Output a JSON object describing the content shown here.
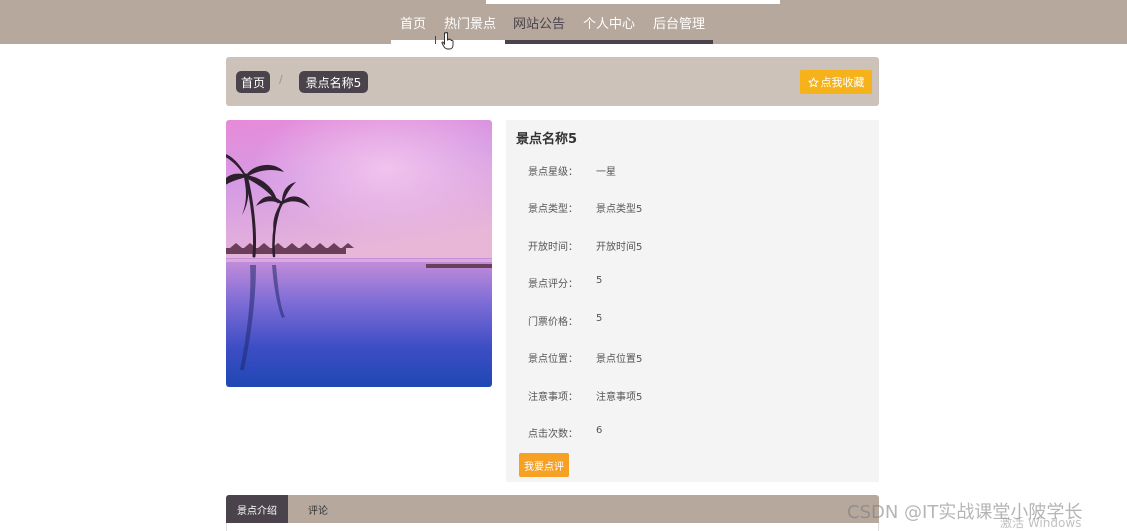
{
  "nav": {
    "items": [
      {
        "label": "首页",
        "state": "active"
      },
      {
        "label": "热门景点",
        "state": "normal"
      },
      {
        "label": "网站公告",
        "state": "dark"
      },
      {
        "label": "个人中心",
        "state": "normal"
      },
      {
        "label": "后台管理",
        "state": "normal"
      }
    ]
  },
  "breadcrumb": {
    "home": "首页",
    "separator": "/",
    "current": "景点名称5"
  },
  "favorite_button": {
    "icon": "star-outline-icon",
    "label": "点我收藏"
  },
  "detail": {
    "title": "景点名称5",
    "fields": [
      {
        "key": "景点星级：",
        "value": "一星"
      },
      {
        "key": "景点类型：",
        "value": "景点类型5"
      },
      {
        "key": "开放时间：",
        "value": "开放时间5"
      },
      {
        "key": "景点评分：",
        "value": "5"
      },
      {
        "key": "门票价格：",
        "value": "5"
      },
      {
        "key": "景点位置：",
        "value": "景点位置5"
      },
      {
        "key": "注意事项：",
        "value": "注意事项5"
      },
      {
        "key": "点击次数：",
        "value": "6"
      }
    ],
    "comment_button": "我要点评"
  },
  "tabs": [
    {
      "label": "景点介绍",
      "active": true
    },
    {
      "label": "评论",
      "active": false
    }
  ],
  "watermarks": {
    "csdn": "CSDN @IT实战课堂小陂学长",
    "windows": "激活 Windows"
  },
  "colors": {
    "nav_bg": "#b6a89d",
    "dark_accent": "#4a434b",
    "breadcrumb_bg": "#ccc2ba",
    "favorite_btn": "#f6b21b",
    "comment_btn": "#f6a124",
    "panel_bg": "#f4f4f4"
  }
}
